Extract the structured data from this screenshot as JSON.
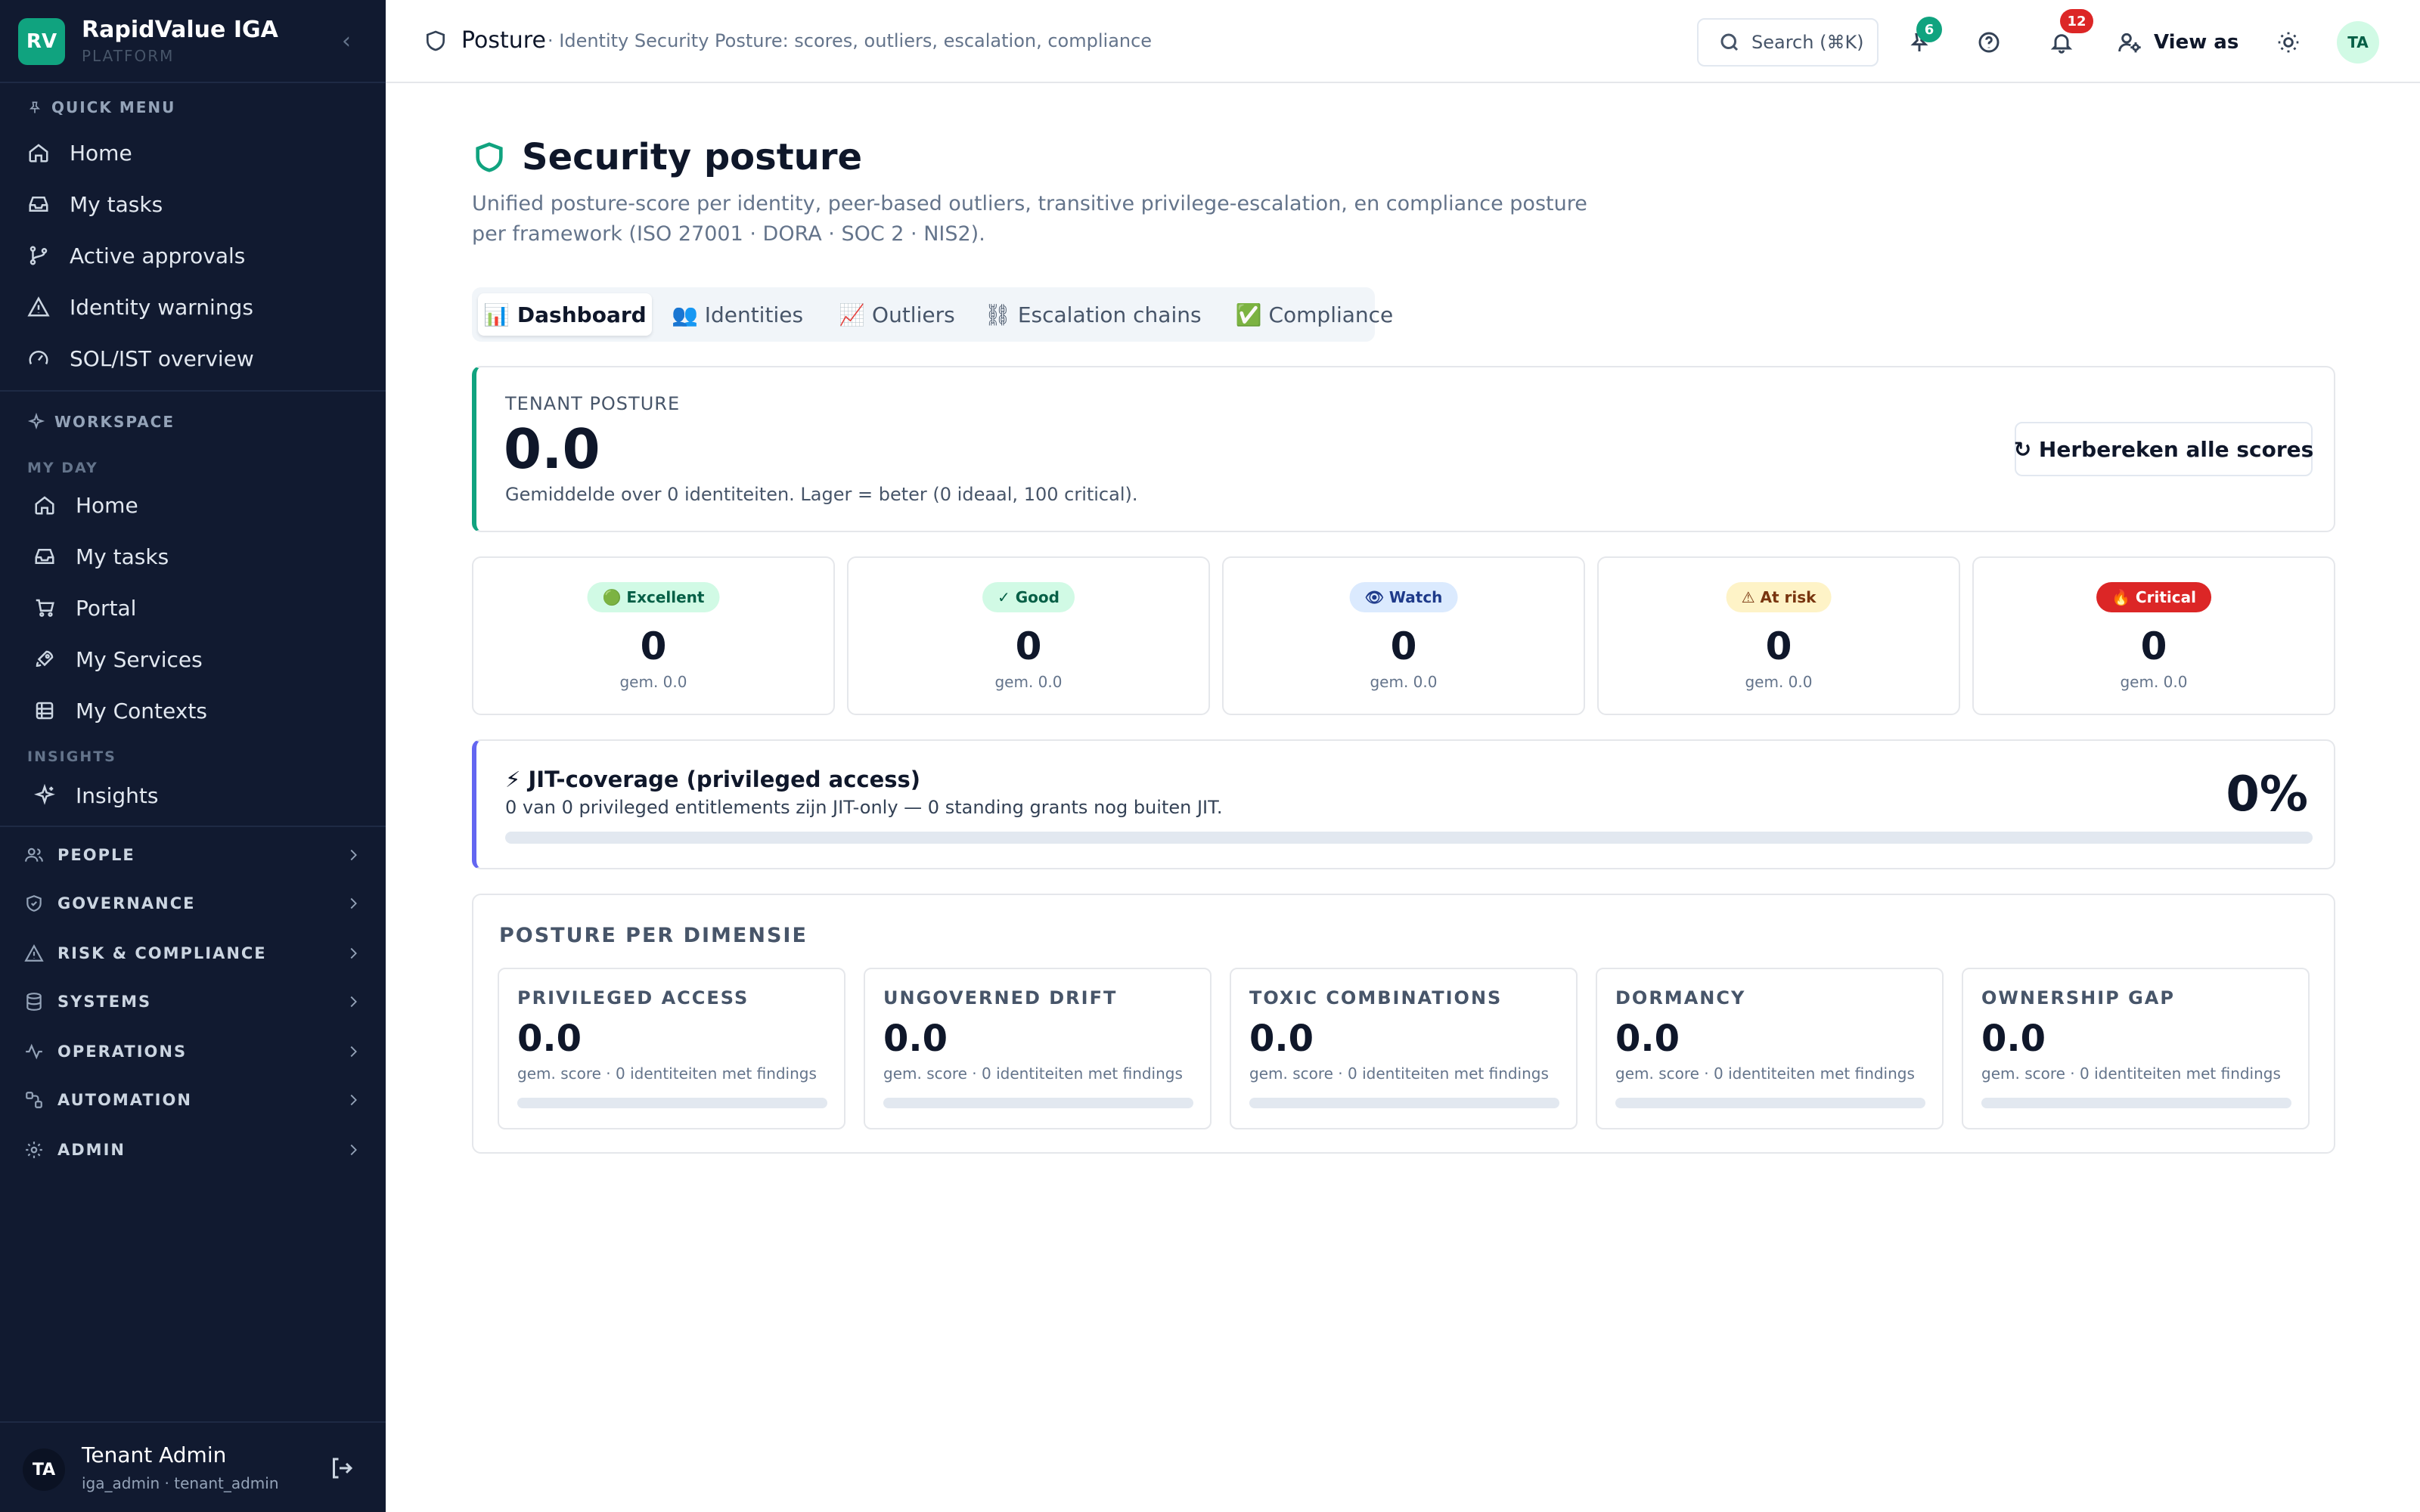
{
  "brand": {
    "initials": "RV",
    "name": "RapidValue IGA",
    "subtitle": "PLATFORM"
  },
  "sidebar": {
    "quick_menu_label": "QUICK MENU",
    "quick_menu": [
      {
        "label": "Home",
        "icon": "home-icon"
      },
      {
        "label": "My tasks",
        "icon": "inbox-icon"
      },
      {
        "label": "Active approvals",
        "icon": "git-branch-icon"
      },
      {
        "label": "Identity warnings",
        "icon": "warning-icon"
      },
      {
        "label": "SOL/IST overview",
        "icon": "gauge-icon"
      }
    ],
    "workspace_label": "WORKSPACE",
    "my_day_label": "MY DAY",
    "my_day": [
      {
        "label": "Home",
        "icon": "home-icon"
      },
      {
        "label": "My tasks",
        "icon": "inbox-icon"
      },
      {
        "label": "Portal",
        "icon": "cart-icon"
      },
      {
        "label": "My Services",
        "icon": "rocket-icon"
      },
      {
        "label": "My Contexts",
        "icon": "database-icon"
      }
    ],
    "insights_label": "INSIGHTS",
    "insights": [
      {
        "label": "Insights",
        "icon": "sparkles-icon"
      }
    ],
    "groups": [
      {
        "label": "PEOPLE",
        "icon": "users-icon"
      },
      {
        "label": "GOVERNANCE",
        "icon": "shield-check-icon"
      },
      {
        "label": "RISK & COMPLIANCE",
        "icon": "warning-icon"
      },
      {
        "label": "SYSTEMS",
        "icon": "database-icon"
      },
      {
        "label": "OPERATIONS",
        "icon": "activity-icon"
      },
      {
        "label": "AUTOMATION",
        "icon": "workflow-icon"
      },
      {
        "label": "ADMIN",
        "icon": "gear-icon"
      }
    ]
  },
  "user": {
    "initials": "TA",
    "name": "Tenant Admin",
    "roles": "iga_admin · tenant_admin"
  },
  "topbar": {
    "title": "Posture",
    "subtitle": "· Identity Security Posture: scores, outliers, escalation, compliance",
    "search_label": "Search (⌘K)",
    "pins_badge": "6",
    "notifications_badge": "12",
    "view_as_label": "View as",
    "avatar_initials": "TA"
  },
  "page": {
    "title": "Security posture",
    "description": "Unified posture-score per identity, peer-based outliers, transitive privilege-escalation, en compliance posture per framework (ISO 27001 · DORA · SOC 2 · NIS2).",
    "tabs": [
      {
        "label": "📊 Dashboard",
        "active": true
      },
      {
        "label": "👥 Identities",
        "active": false
      },
      {
        "label": "📈 Outliers",
        "active": false
      },
      {
        "label": "⛓ Escalation chains",
        "active": false
      },
      {
        "label": "✅ Compliance",
        "active": false
      }
    ]
  },
  "tenant_posture": {
    "label": "TENANT POSTURE",
    "value": "0.0",
    "note": "Gemiddelde over 0 identiteiten. Lager = beter (0 ideaal, 100 critical).",
    "recalc_label": "↻ Herbereken alle scores"
  },
  "bands": [
    {
      "label": "🟢 Excellent",
      "count": "0",
      "avg": "gem. 0.0",
      "bg": "#d1fae5",
      "fg": "#065f46"
    },
    {
      "label": "✓ Good",
      "count": "0",
      "avg": "gem. 0.0",
      "bg": "#d1fae5",
      "fg": "#065f46"
    },
    {
      "label": "👁 Watch",
      "count": "0",
      "avg": "gem. 0.0",
      "bg": "#dbeafe",
      "fg": "#1e3a8a"
    },
    {
      "label": "⚠ At risk",
      "count": "0",
      "avg": "gem. 0.0",
      "bg": "#fef3c7",
      "fg": "#78350f"
    },
    {
      "label": "🔥 Critical",
      "count": "0",
      "avg": "gem. 0.0",
      "bg": "#dc2626",
      "fg": "#ffffff"
    }
  ],
  "jit": {
    "title": "⚡ JIT-coverage (privileged access)",
    "subtitle": "0 van 0 privileged entitlements zijn JIT-only — 0 standing grants nog buiten JIT.",
    "percent_label": "0%",
    "coverage_fraction": 0
  },
  "dimensions": {
    "title": "POSTURE PER DIMENSIE",
    "items": [
      {
        "name": "PRIVILEGED ACCESS",
        "value": "0.0",
        "note": "gem. score · 0 identiteiten met findings",
        "fraction": 0
      },
      {
        "name": "UNGOVERNED DRIFT",
        "value": "0.0",
        "note": "gem. score · 0 identiteiten met findings",
        "fraction": 0
      },
      {
        "name": "TOXIC COMBINATIONS",
        "value": "0.0",
        "note": "gem. score · 0 identiteiten met findings",
        "fraction": 0
      },
      {
        "name": "DORMANCY",
        "value": "0.0",
        "note": "gem. score · 0 identiteiten met findings",
        "fraction": 0
      },
      {
        "name": "OWNERSHIP GAP",
        "value": "0.0",
        "note": "gem. score · 0 identiteiten met findings",
        "fraction": 0
      }
    ]
  },
  "colors": {
    "accent": "#10a37f",
    "sidebar_bg": "#111a30",
    "jit_accent": "#6366f1",
    "pins_badge": "#10a37f",
    "notifications_badge": "#dc2626"
  }
}
